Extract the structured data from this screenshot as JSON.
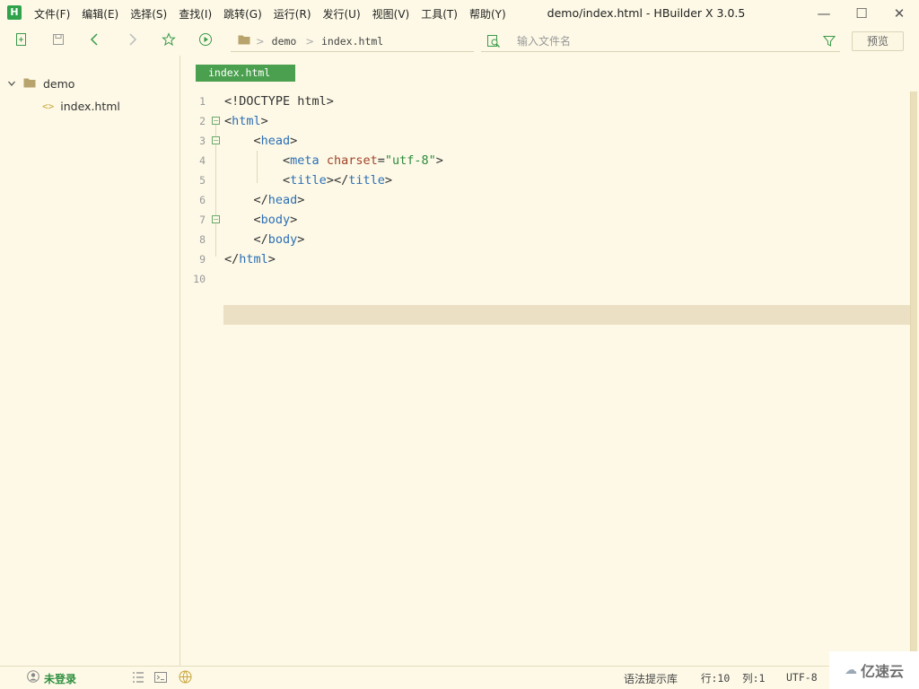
{
  "app": {
    "logo": "H",
    "window_title": "demo/index.html - HBuilder X 3.0.5",
    "menu": [
      "文件(F)",
      "编辑(E)",
      "选择(S)",
      "查找(I)",
      "跳转(G)",
      "运行(R)",
      "发行(U)",
      "视图(V)",
      "工具(T)",
      "帮助(Y)"
    ],
    "window_controls": {
      "minimize": "—",
      "maximize": "☐",
      "close": "✕"
    }
  },
  "toolbar": {
    "icons": [
      "new-file-icon",
      "save-icon",
      "back-icon",
      "forward-icon",
      "favorite-star-icon",
      "run-icon"
    ],
    "breadcrumb": [
      "demo",
      "index.html"
    ],
    "breadcrumb_separator": ">",
    "file_search_placeholder": "输入文件名",
    "preview_label": "预览"
  },
  "sidebar": {
    "project": "demo",
    "files": [
      {
        "name": "index.html",
        "icon": "<>"
      }
    ]
  },
  "editor": {
    "active_tab": "index.html",
    "line_numbers": [
      "1",
      "2",
      "3",
      "4",
      "5",
      "6",
      "7",
      "8",
      "9",
      "10"
    ],
    "current_line": 10
  },
  "statusbar": {
    "login": "未登录",
    "syntax_hint": "语法提示库",
    "position": "行:10  列:1",
    "encoding": "UTF-8"
  },
  "watermark": {
    "text": "亿速云"
  },
  "colors": {
    "accent": "#2fa24b",
    "background": "#fdf9e6",
    "tag": "#2b6fb6",
    "attr": "#a0432a",
    "string": "#2a8a3c"
  }
}
